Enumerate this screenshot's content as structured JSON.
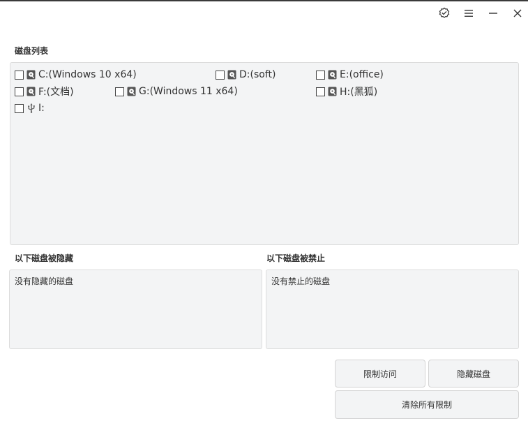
{
  "titlebar": {
    "icons": [
      "badge-check-icon",
      "menu-icon",
      "minimize-icon",
      "close-icon"
    ]
  },
  "disk_list": {
    "label": "磁盘列表",
    "disks": [
      {
        "name": "C:(Windows 10 x64)",
        "icon": "drive-icon",
        "checked": false
      },
      {
        "name": "D:(soft)",
        "icon": "drive-icon",
        "checked": false
      },
      {
        "name": "E:(office)",
        "icon": "drive-icon",
        "checked": false
      },
      {
        "name": "F:(文档)",
        "icon": "drive-icon",
        "checked": false
      },
      {
        "name": "G:(Windows 11 x64)",
        "icon": "drive-icon",
        "checked": false
      },
      {
        "name": "H:(黑狐)",
        "icon": "drive-icon",
        "checked": false
      },
      {
        "name": "I:",
        "icon": "usb-icon",
        "checked": false
      }
    ]
  },
  "hidden_panel": {
    "label": "以下磁盘被隐藏",
    "empty_text": "没有隐藏的磁盘"
  },
  "disabled_panel": {
    "label": "以下磁盘被禁止",
    "empty_text": "没有禁止的磁盘"
  },
  "buttons": {
    "restrict_access": "限制访问",
    "hide_disk": "隐藏磁盘",
    "clear_all": "清除所有限制"
  }
}
